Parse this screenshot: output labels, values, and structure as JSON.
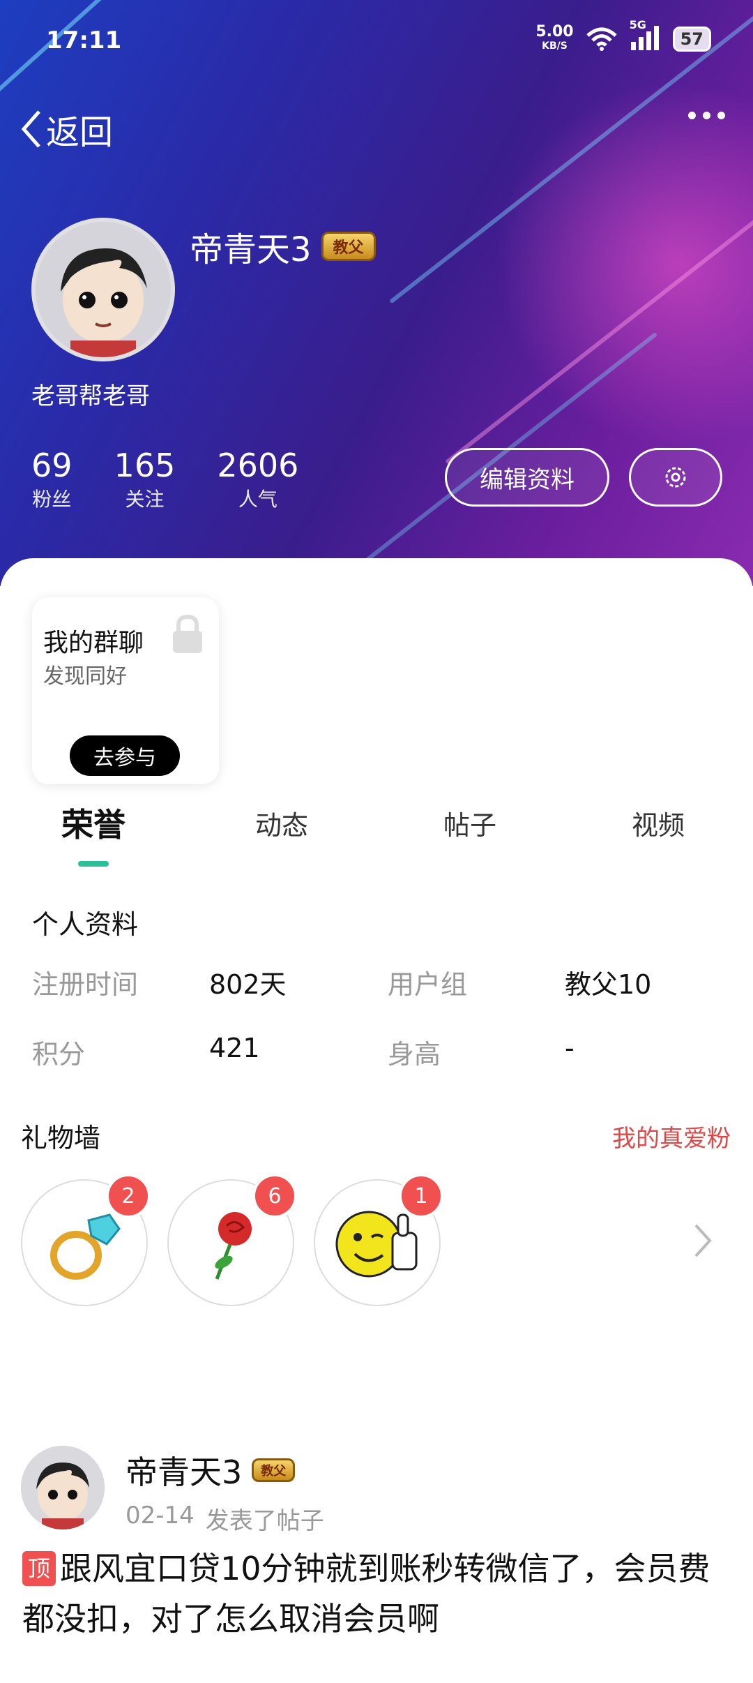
{
  "status_bar": {
    "time": "17:11",
    "speed_value": "5.00",
    "speed_unit": "KB/S",
    "network": "5G",
    "battery": "57"
  },
  "nav": {
    "back_label": "返回"
  },
  "profile": {
    "name": "帝青天3",
    "badge": "教父",
    "bio": "老哥帮老哥",
    "stats": [
      {
        "value": "69",
        "label": "粉丝"
      },
      {
        "value": "165",
        "label": "关注"
      },
      {
        "value": "2606",
        "label": "人气"
      }
    ],
    "edit_button": "编辑资料"
  },
  "group_card": {
    "title": "我的群聊",
    "subtitle": "发现同好",
    "join_button": "去参与"
  },
  "tabs": [
    {
      "label": "荣誉",
      "active": true
    },
    {
      "label": "动态",
      "active": false
    },
    {
      "label": "帖子",
      "active": false
    },
    {
      "label": "视频",
      "active": false
    }
  ],
  "personal_info": {
    "title": "个人资料",
    "rows": [
      {
        "k1": "注册时间",
        "v1": "802天",
        "k2": "用户组",
        "v2": "教父10"
      },
      {
        "k1": "积分",
        "v1": "421",
        "k2": "身高",
        "v2": "-"
      }
    ]
  },
  "gift_wall": {
    "title": "礼物墙",
    "link": "我的真爱粉",
    "gifts": [
      {
        "name": "ring-icon",
        "count": "2"
      },
      {
        "name": "rose-icon",
        "count": "6"
      },
      {
        "name": "thumbs-up-emoji-icon",
        "count": "1"
      }
    ]
  },
  "post": {
    "author": "帝青天3",
    "badge": "教父",
    "date": "02-14",
    "action": "发表了帖子",
    "top_tag": "顶",
    "text": "跟风宜口贷10分钟就到账秒转微信了，会员费都没扣，对了怎么取消会员啊"
  },
  "colors": {
    "accent": "#2bbf9a",
    "highlight": "#e04848",
    "badge_red": "#f05050"
  }
}
